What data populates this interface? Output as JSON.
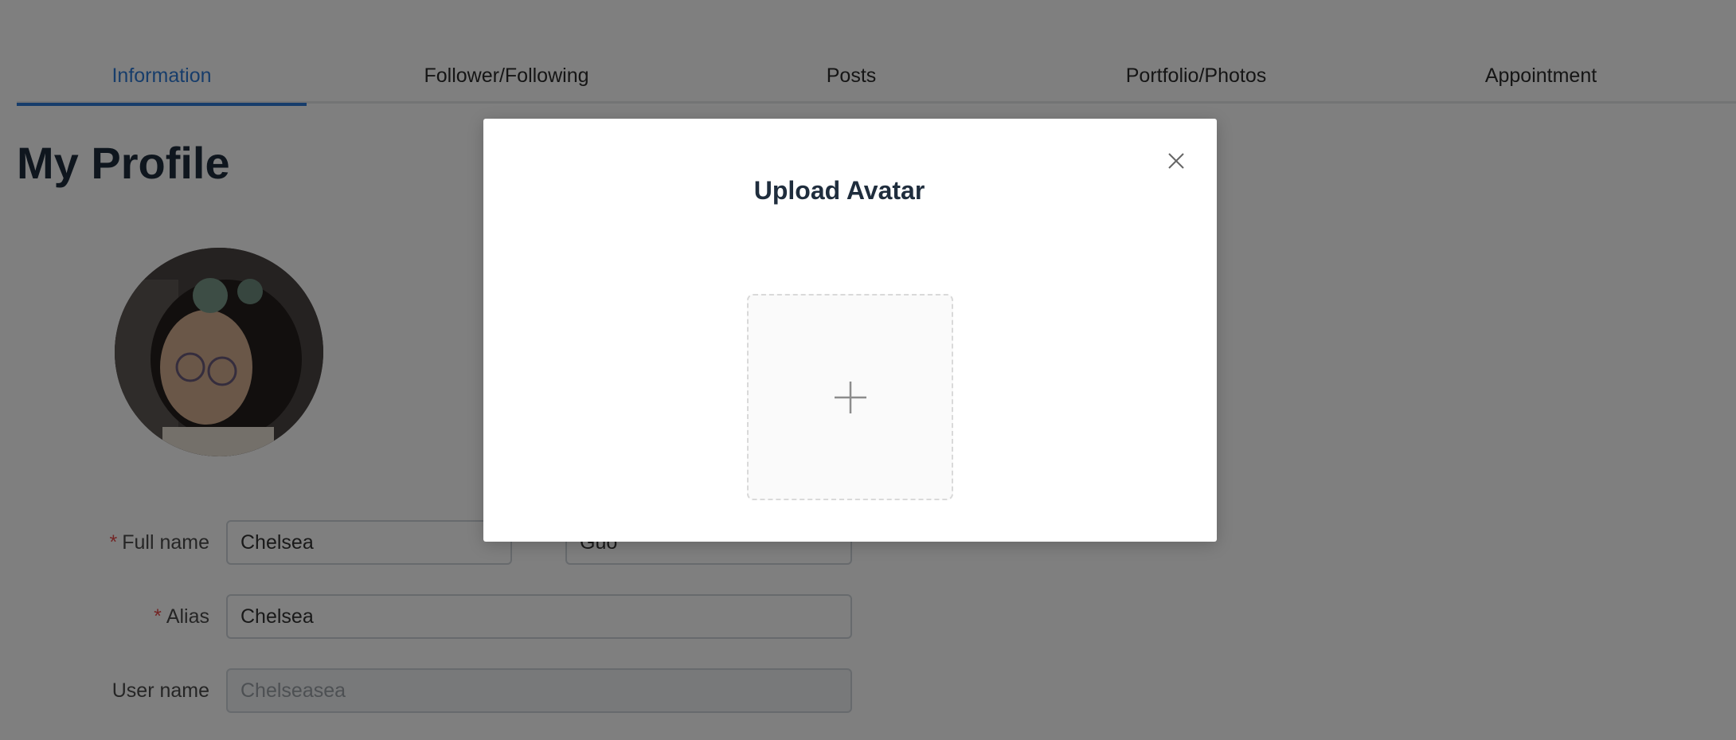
{
  "tabs": [
    {
      "label": "Information",
      "active": true
    },
    {
      "label": "Follower/Following",
      "active": false
    },
    {
      "label": "Posts",
      "active": false
    },
    {
      "label": "Portfolio/Photos",
      "active": false
    },
    {
      "label": "Appointment",
      "active": false
    }
  ],
  "profile": {
    "title": "My Profile",
    "form": {
      "full_name_label": "Full name",
      "first_name_value": "Chelsea",
      "last_name_value": "Guo",
      "alias_label": "Alias",
      "alias_value": "Chelsea",
      "username_label": "User name",
      "username_value": "Chelseasea",
      "required_mark": "*"
    }
  },
  "modal": {
    "title": "Upload Avatar",
    "close_icon": "close-icon",
    "upload_icon": "plus-icon"
  },
  "colors": {
    "accent": "#2f7bd6",
    "required": "#e64a4a",
    "overlay": "rgba(0,0,0,0.5)"
  }
}
